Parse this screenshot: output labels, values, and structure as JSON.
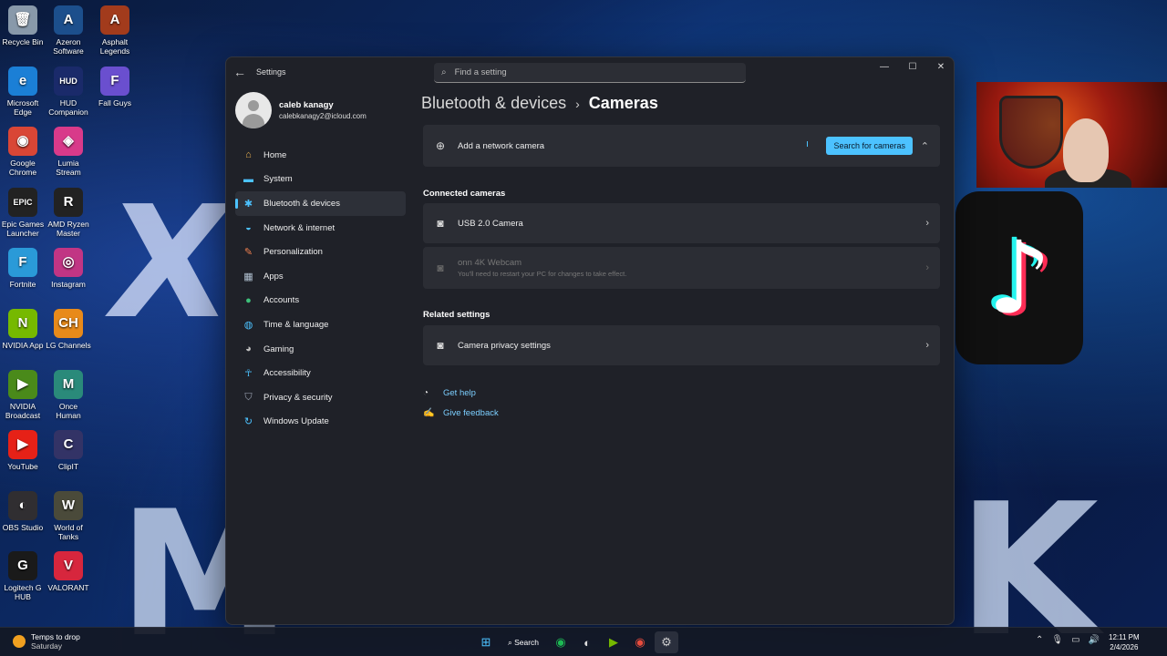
{
  "desktop": {
    "icons": [
      {
        "label": "Recycle Bin",
        "glyph": "🗑",
        "color": "#8899aa"
      },
      {
        "label": "Azeron Software",
        "glyph": "A",
        "color": "#1c4f8c"
      },
      {
        "label": "Asphalt Legends",
        "glyph": "A",
        "color": "#a23b1c"
      },
      {
        "label": "Microsoft Edge",
        "glyph": "e",
        "color": "#1b7fd6"
      },
      {
        "label": "HUD Companion",
        "glyph": "HUD",
        "color": "#1a2a6a"
      },
      {
        "label": "Fall Guys",
        "glyph": "F",
        "color": "#6a4fcf"
      },
      {
        "label": "Google Chrome",
        "glyph": "◉",
        "color": "#d94636"
      },
      {
        "label": "Lumia Stream",
        "glyph": "◈",
        "color": "#d83a8a"
      },
      {
        "label": "Epic Games Launcher",
        "glyph": "EPIC",
        "color": "#222222"
      },
      {
        "label": "AMD Ryzen Master",
        "glyph": "R",
        "color": "#222222"
      },
      {
        "label": "Fortnite",
        "glyph": "F",
        "color": "#2a9ad8"
      },
      {
        "label": "Instagram",
        "glyph": "◎",
        "color": "#c13584"
      },
      {
        "label": "NVIDIA App",
        "glyph": "N",
        "color": "#76b900"
      },
      {
        "label": "LG Channels",
        "glyph": "CH",
        "color": "#e88a1a"
      },
      {
        "label": "NVIDIA Broadcast",
        "glyph": "▶",
        "color": "#4a8a1a"
      },
      {
        "label": "Once Human",
        "glyph": "M",
        "color": "#2a8a7a"
      },
      {
        "label": "YouTube",
        "glyph": "▶",
        "color": "#e62117"
      },
      {
        "label": "ClipIT",
        "glyph": "C",
        "color": "#333366"
      },
      {
        "label": "OBS Studio",
        "glyph": "◐",
        "color": "#302e31"
      },
      {
        "label": "World of Tanks",
        "glyph": "W",
        "color": "#4a4a3a"
      },
      {
        "label": "Logitech G HUB",
        "glyph": "G",
        "color": "#1a1a1a"
      },
      {
        "label": "VALORANT",
        "glyph": "V",
        "color": "#d7263d"
      }
    ]
  },
  "window": {
    "title": "Settings",
    "search_placeholder": "Find a setting",
    "profile": {
      "name": "caleb kanagy",
      "email": "calebkanagy2@icloud.com"
    },
    "nav": [
      {
        "label": "Home",
        "icon": "home-icon",
        "glyph": "⌂",
        "color": "#e8b050",
        "active": false
      },
      {
        "label": "System",
        "icon": "system-icon",
        "glyph": "▬",
        "color": "#4cc2ff",
        "active": false
      },
      {
        "label": "Bluetooth & devices",
        "icon": "bluetooth-icon",
        "glyph": "✱",
        "color": "#4cc2ff",
        "active": true
      },
      {
        "label": "Network & internet",
        "icon": "wifi-icon",
        "glyph": "◒",
        "color": "#4cc2ff",
        "active": false
      },
      {
        "label": "Personalization",
        "icon": "brush-icon",
        "glyph": "✎",
        "color": "#f08050",
        "active": false
      },
      {
        "label": "Apps",
        "icon": "apps-icon",
        "glyph": "▦",
        "color": "#b0c0d0",
        "active": false
      },
      {
        "label": "Accounts",
        "icon": "accounts-icon",
        "glyph": "●",
        "color": "#3ec07a",
        "active": false
      },
      {
        "label": "Time & language",
        "icon": "globe-icon",
        "glyph": "◍",
        "color": "#4cc2ff",
        "active": false
      },
      {
        "label": "Gaming",
        "icon": "gaming-icon",
        "glyph": "◕",
        "color": "#c0c0c0",
        "active": false
      },
      {
        "label": "Accessibility",
        "icon": "accessibility-icon",
        "glyph": "☥",
        "color": "#4cc2ff",
        "active": false
      },
      {
        "label": "Privacy & security",
        "icon": "shield-icon",
        "glyph": "⛉",
        "color": "#a0a8b8",
        "active": false
      },
      {
        "label": "Windows Update",
        "icon": "update-icon",
        "glyph": "↻",
        "color": "#4cc2ff",
        "active": false
      }
    ],
    "breadcrumb": {
      "parent": "Bluetooth & devices",
      "separator": "›",
      "current": "Cameras"
    },
    "add_camera": {
      "label": "Add a network camera",
      "button": "Search for cameras"
    },
    "connected": {
      "heading": "Connected cameras",
      "items": [
        {
          "label": "USB 2.0 Camera",
          "sub": "",
          "disabled": false
        },
        {
          "label": "onn 4K Webcam",
          "sub": "You'll need to restart your PC for changes to take effect.",
          "disabled": true
        }
      ]
    },
    "related": {
      "heading": "Related settings",
      "item": "Camera privacy settings"
    },
    "links": {
      "help": "Get help",
      "feedback": "Give feedback"
    }
  },
  "taskbar": {
    "weather_title": "Temps to drop",
    "weather_sub": "Saturday",
    "search_label": "Search",
    "time": "12:11 PM",
    "date": "2/4/2026"
  },
  "colors": {
    "accent": "#4cc2ff",
    "window_bg": "#1f2128",
    "card_bg": "#2b2d34"
  }
}
